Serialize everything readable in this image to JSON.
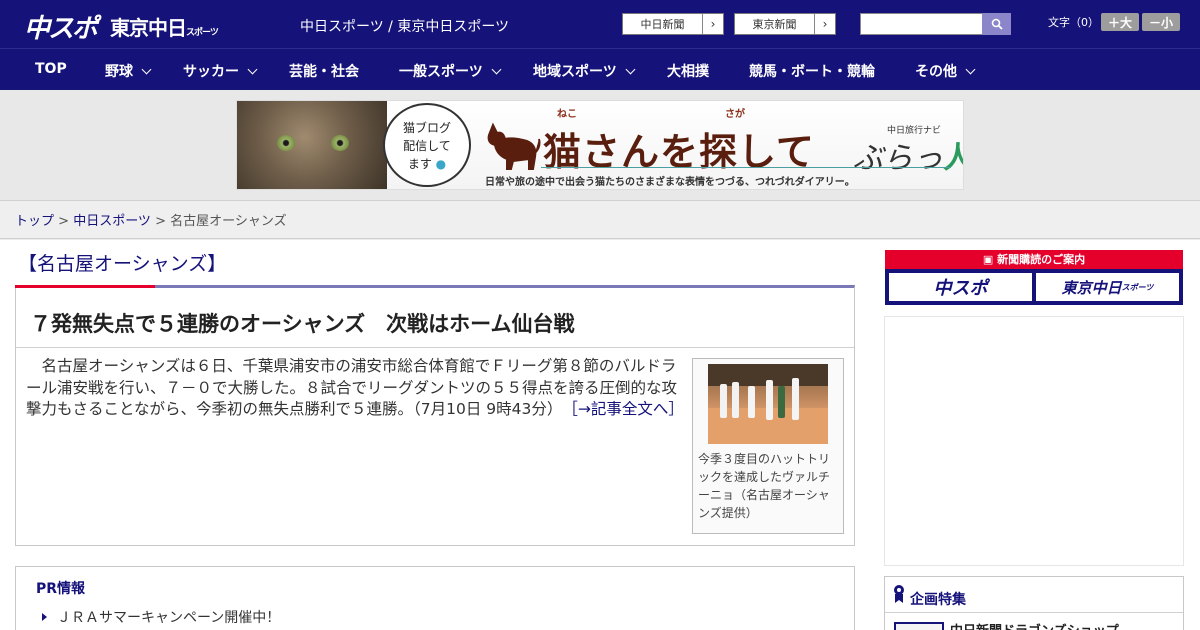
{
  "header": {
    "logo_chuspo": "中スポ",
    "logo_tokyo": "東京中日",
    "logo_tokyo_small": "スポーツ",
    "site_name": "中日スポーツ / 東京中日スポーツ",
    "ext_links": [
      "中日新聞",
      "東京新聞"
    ],
    "search_placeholder": "",
    "font_size_label": "文字（0）",
    "size_up": "＋大",
    "size_down": "－小"
  },
  "nav": {
    "items": [
      {
        "label": "TOP",
        "dropdown": false
      },
      {
        "label": "野球",
        "dropdown": true
      },
      {
        "label": "サッカー",
        "dropdown": true
      },
      {
        "label": "芸能・社会",
        "dropdown": false
      },
      {
        "label": "一般スポーツ",
        "dropdown": true
      },
      {
        "label": "地域スポーツ",
        "dropdown": true
      },
      {
        "label": "大相撲",
        "dropdown": false
      },
      {
        "label": "競馬・ボート・競輪",
        "dropdown": false
      },
      {
        "label": "その他",
        "dropdown": true
      }
    ]
  },
  "banner": {
    "bubble_text_1": "猫ブログ",
    "bubble_text_2": "配信して",
    "bubble_text_3": "ます",
    "ruby_neko": "ねこ",
    "ruby_saga": "さが",
    "title": "猫さんを探して",
    "brand_small": "中日旅行ナビ",
    "brand_big": "ぶらっ",
    "brand_hito": "人",
    "subtitle": "日常や旅の途中で出会う猫たちのさまざまな表情をつづる、つれづれダイアリー。"
  },
  "breadcrumb": {
    "top": "トップ",
    "sep": " > ",
    "parent": "中日スポーツ",
    "current": "名古屋オーシャンズ"
  },
  "section": {
    "title": "【名古屋オーシャンズ】"
  },
  "article": {
    "headline": "７発無失点で５連勝のオーシャンズ　次戦はホーム仙台戦",
    "body": "名古屋オーシャンズは６日、千葉県浦安市の浦安市総合体育館でＦリーグ第８節のバルドラール浦安戦を行い、７－０で大勝した。８試合でリーグダントツの５５得点を誇る圧倒的な攻撃力もさることながら、今季初の無失点勝利で５連勝。（7月10日 9時43分）",
    "more_link": "［→記事全文へ］",
    "photo_caption": "今季３度目のハットトリックを達成したヴァルチーニョ（名古屋オーシャンズ提供）"
  },
  "pr": {
    "title": "PR情報",
    "items": [
      "ＪＲＡサマーキャンペーン開催中！"
    ]
  },
  "sidebar": {
    "subscription_header": "新聞購読のご案内",
    "subscription_chuspo": "中スポ",
    "subscription_tokyo": "東京中日",
    "subscription_tokyo_small": "スポーツ",
    "feature_title": "企画特集",
    "feature_items": [
      "中日新聞ドラゴンズショップ"
    ]
  },
  "colors": {
    "brand_navy": "#15127a",
    "accent_red": "#e4002b"
  }
}
